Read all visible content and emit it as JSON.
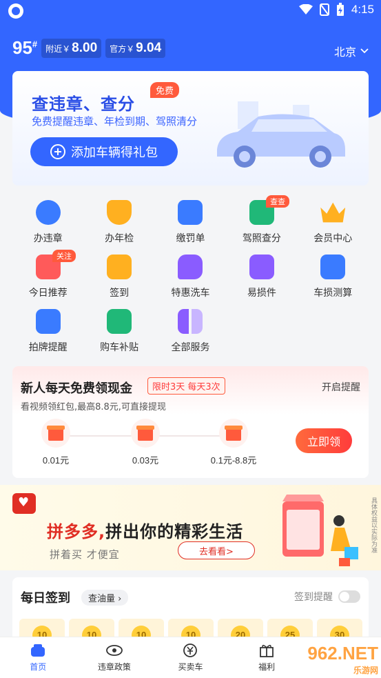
{
  "status_bar": {
    "time": "4:15"
  },
  "header": {
    "fuel_grade": "95",
    "fuel_grade_sup": "#",
    "nearby_label": "附近￥",
    "nearby_price": "8.00",
    "official_label": "官方￥",
    "official_price": "9.04",
    "city": "北京"
  },
  "banner": {
    "title": "查违章、查分",
    "badge": "免费",
    "subtitle": "免费提醒违章、年检到期、驾照清分",
    "button": "添加车辆得礼包"
  },
  "services": [
    [
      {
        "label": "办违章",
        "icon": "violation-icon",
        "color": "#3a7bff",
        "tag": ""
      },
      {
        "label": "办年检",
        "icon": "inspection-icon",
        "color": "#ffb020",
        "tag": ""
      },
      {
        "label": "缴罚单",
        "icon": "ticket-icon",
        "color": "#3a7bff",
        "tag": ""
      },
      {
        "label": "驾照查分",
        "icon": "license-icon",
        "color": "#20b878",
        "tag": "查查"
      },
      {
        "label": "会员中心",
        "icon": "crown-icon",
        "color": "#ffb020",
        "tag": ""
      }
    ],
    [
      {
        "label": "今日推荐",
        "icon": "recommend-icon",
        "color": "#ff5a5a",
        "tag": "关注"
      },
      {
        "label": "签到",
        "icon": "checkin-icon",
        "color": "#ffb020",
        "tag": ""
      },
      {
        "label": "特惠洗车",
        "icon": "carwash-icon",
        "color": "#8a5cff",
        "tag": ""
      },
      {
        "label": "易损件",
        "icon": "parts-icon",
        "color": "#8a5cff",
        "tag": ""
      },
      {
        "label": "车损测算",
        "icon": "damage-icon",
        "color": "#3a7bff",
        "tag": ""
      }
    ],
    [
      {
        "label": "拍牌提醒",
        "icon": "plate-icon",
        "color": "#3a7bff",
        "tag": ""
      },
      {
        "label": "购车补贴",
        "icon": "subsidy-icon",
        "color": "#20b878",
        "tag": ""
      },
      {
        "label": "全部服务",
        "icon": "grid-icon",
        "color": "#8a5cff",
        "tag": ""
      }
    ]
  ],
  "cash_card": {
    "title": "新人每天免费领现金",
    "limit_tag": "限时3天 每天3次",
    "remind": "开启提醒",
    "subtitle": "看视频领红包,最高8.8元,可直接提现",
    "gifts": [
      "0.01元",
      "0.03元",
      "0.1元-8.8元"
    ],
    "button": "立即领"
  },
  "ad": {
    "brand": "拼多多,",
    "title_rest": "拼出你的精彩生活",
    "subtitle": "拼着买  才便宜",
    "button": "去看看>",
    "side_note": "具体权益以实际为准"
  },
  "checkin": {
    "title": "每日签到",
    "oil_link": "查油量 ›",
    "remind_label": "签到提醒",
    "days": [
      "10",
      "10",
      "10",
      "10",
      "20",
      "25",
      "30"
    ]
  },
  "tabbar": [
    {
      "label": "首页",
      "active": true
    },
    {
      "label": "违章政策",
      "active": false
    },
    {
      "label": "买卖车",
      "active": false
    },
    {
      "label": "福利",
      "active": false
    },
    {
      "label": "",
      "active": false
    }
  ],
  "watermark": {
    "main": "962.NET",
    "sub": "乐游网"
  }
}
